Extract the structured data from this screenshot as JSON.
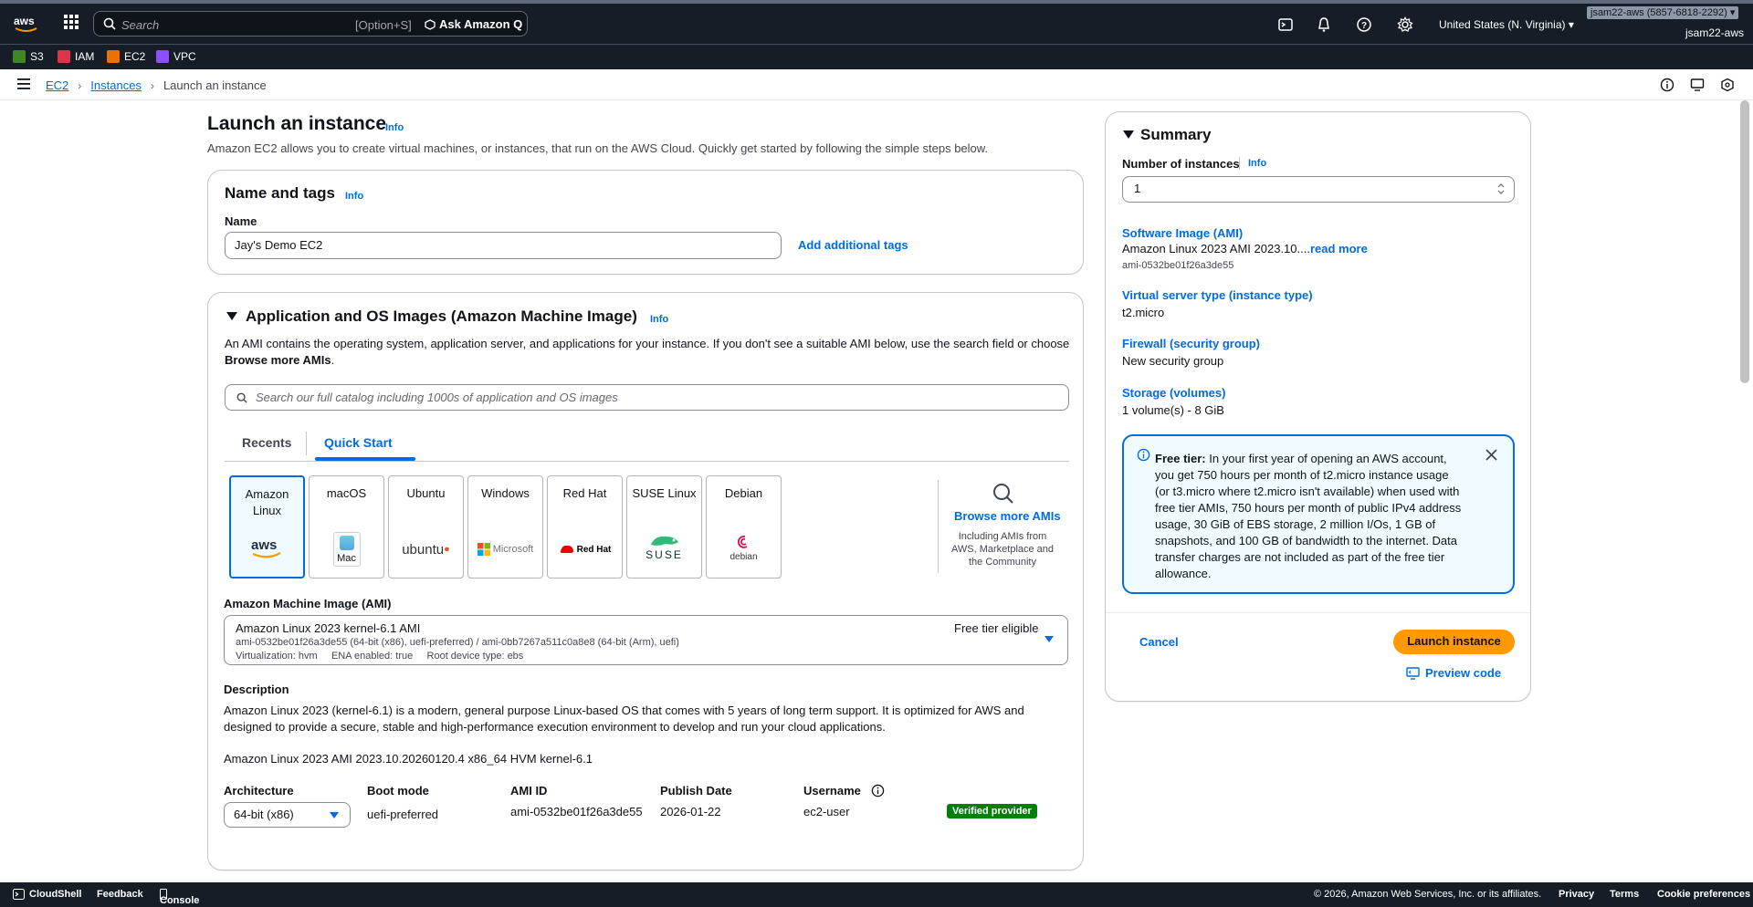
{
  "topnav": {
    "search_placeholder": "Search",
    "search_shortcut": "[Option+S]",
    "ask_q": "Ask Amazon Q",
    "region": "United States (N. Virginia)",
    "account_badge": "jsam22-aws (5857-6818-2292)",
    "account": "jsam22-aws"
  },
  "favorites": [
    {
      "label": "S3",
      "color": "#3f8624"
    },
    {
      "label": "IAM",
      "color": "#dd344c"
    },
    {
      "label": "EC2",
      "color": "#ed7100"
    },
    {
      "label": "VPC",
      "color": "#8c4fff"
    }
  ],
  "breadcrumb": {
    "ec2": "EC2",
    "instances": "Instances",
    "current": "Launch an instance"
  },
  "page": {
    "title": "Launch an instance",
    "info": "Info",
    "subtitle": "Amazon EC2 allows you to create virtual machines, or instances, that run on the AWS Cloud. Quickly get started by following the simple steps below."
  },
  "name_tags": {
    "title": "Name and tags",
    "info": "Info",
    "name_label": "Name",
    "name_value": "Jay's Demo EC2",
    "add_tags": "Add additional tags"
  },
  "ami_section": {
    "title": "Application and OS Images (Amazon Machine Image)",
    "info": "Info",
    "desc1": "An AMI contains the operating system, application server, and applications for your instance. If you don't see a suitable AMI below, use the search field or choose",
    "desc2": "Browse more AMIs",
    "desc2_end": ".",
    "search_placeholder": "Search our full catalog including 1000s of application and OS images",
    "tabs": [
      "Recents",
      "Quick Start"
    ],
    "tiles": [
      "Amazon Linux",
      "macOS",
      "Ubuntu",
      "Windows",
      "Red Hat",
      "SUSE Linux",
      "Debian"
    ],
    "tile_logos": {
      "mac": "Mac",
      "ubuntu": "ubuntu",
      "microsoft": "Microsoft",
      "redhat": "Red Hat",
      "suse": "SUSE",
      "debian": "debian"
    },
    "browse_more": "Browse more AMIs",
    "browse_sub": [
      "Including AMIs from",
      "AWS, Marketplace and",
      "the Community"
    ],
    "ami_label": "Amazon Machine Image (AMI)",
    "ami_name": "Amazon Linux 2023 kernel-6.1 AMI",
    "ami_ids": "ami-0532be01f26a3de55 (64-bit (x86), uefi-preferred) / ami-0bb7267a511c0a8e8 (64-bit (Arm), uefi)",
    "ami_meta": "Virtualization: hvm     ENA enabled: true     Root device type: ebs",
    "free_tier": "Free tier eligible",
    "description_label": "Description",
    "description": "Amazon Linux 2023 (kernel-6.1) is a modern, general purpose Linux-based OS that comes with 5 years of long term support. It is optimized for AWS and designed to provide a secure, stable and high-performance execution environment to develop and run your cloud applications.",
    "ami_full_name": "Amazon Linux 2023 AMI 2023.10.20260120.4 x86_64 HVM kernel-6.1",
    "details": {
      "arch_label": "Architecture",
      "arch_value": "64-bit (x86)",
      "boot_label": "Boot mode",
      "boot_value": "uefi-preferred",
      "amiid_label": "AMI ID",
      "amiid_value": "ami-0532be01f26a3de55",
      "publish_label": "Publish Date",
      "publish_value": "2026-01-22",
      "user_label": "Username",
      "user_value": "ec2-user",
      "verified": "Verified provider"
    }
  },
  "summary": {
    "title": "Summary",
    "num_label": "Number of instances",
    "info": "Info",
    "num_value": "1",
    "ami_label": "Software Image (AMI)",
    "ami_value": "Amazon Linux 2023 AMI 2023.10....",
    "read_more": "read more",
    "ami_id": "ami-0532be01f26a3de55",
    "type_label": "Virtual server type (instance type)",
    "type_value": "t2.micro",
    "fw_label": "Firewall (security group)",
    "fw_value": "New security group",
    "storage_label": "Storage (volumes)",
    "storage_value": "1 volume(s) - 8 GiB",
    "free_title": "Free tier:",
    "free_text": "In your first year of opening an AWS account, you get 750 hours per month of t2.micro instance usage (or t3.micro where t2.micro isn't available) when used with free tier AMIs, 750 hours per month of public IPv4 address usage, 30 GiB of EBS storage, 2 million I/Os, 1 GB of snapshots, and 100 GB of bandwidth to the internet. Data transfer charges are not included as part of the free tier allowance.",
    "cancel": "Cancel",
    "launch": "Launch instance",
    "preview": "Preview code"
  },
  "footer": {
    "cloudshell": "CloudShell",
    "feedback": "Feedback",
    "mobile": "Console Mobile App",
    "copyright": "© 2026, Amazon Web Services, Inc. or its affiliates.",
    "privacy": "Privacy",
    "terms": "Terms",
    "cookies": "Cookie preferences"
  }
}
